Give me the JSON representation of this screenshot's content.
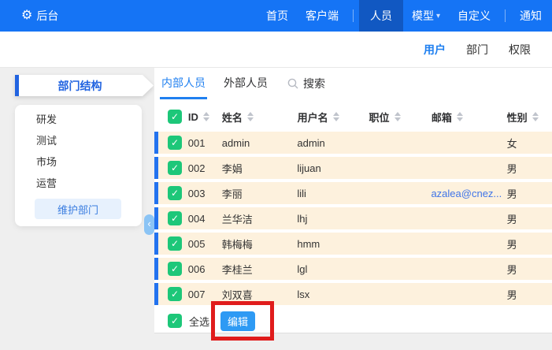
{
  "topbar": {
    "logo": "后台",
    "nav": [
      {
        "label": "首页",
        "active": false
      },
      {
        "label": "客户端",
        "active": false
      },
      {
        "label": "人员",
        "active": true
      },
      {
        "label": "模型",
        "active": false,
        "dropdown": true
      },
      {
        "label": "自定义",
        "active": false
      },
      {
        "label": "通知",
        "active": false
      }
    ]
  },
  "subnav": {
    "tabs": [
      {
        "label": "用户",
        "active": true
      },
      {
        "label": "部门",
        "active": false
      },
      {
        "label": "权限",
        "active": false
      }
    ]
  },
  "sidebar": {
    "title": "部门结构",
    "items": [
      "研发",
      "测试",
      "市场",
      "运营"
    ],
    "maintain_button": "维护部门"
  },
  "content": {
    "tabs": [
      {
        "label": "内部人员",
        "active": true
      },
      {
        "label": "外部人员",
        "active": false
      }
    ],
    "search_label": "搜索",
    "table": {
      "columns": [
        "ID",
        "姓名",
        "用户名",
        "职位",
        "邮箱",
        "性别"
      ],
      "rows": [
        {
          "id": "001",
          "name": "admin",
          "username": "admin",
          "position": "",
          "email": "",
          "gender": "女",
          "checked": true
        },
        {
          "id": "002",
          "name": "李娟",
          "username": "lijuan",
          "position": "",
          "email": "",
          "gender": "男",
          "checked": true
        },
        {
          "id": "003",
          "name": "李丽",
          "username": "lili",
          "position": "",
          "email": "azalea@cnez...",
          "gender": "男",
          "checked": true
        },
        {
          "id": "004",
          "name": "兰华洁",
          "username": "lhj",
          "position": "",
          "email": "",
          "gender": "男",
          "checked": true
        },
        {
          "id": "005",
          "name": "韩梅梅",
          "username": "hmm",
          "position": "",
          "email": "",
          "gender": "男",
          "checked": true
        },
        {
          "id": "006",
          "name": "李桂兰",
          "username": "lgl",
          "position": "",
          "email": "",
          "gender": "男",
          "checked": true
        },
        {
          "id": "007",
          "name": "刘双喜",
          "username": "lsx",
          "position": "",
          "email": "",
          "gender": "男",
          "checked": true
        }
      ],
      "select_all_label": "全选",
      "edit_button_label": "编辑"
    }
  },
  "icons": {
    "gear": "⚙",
    "check": "✓",
    "chevron_left": "‹",
    "caret_down": "▾"
  },
  "colors": {
    "topbar_blue": "#1574f5",
    "topbar_active_blue": "#1158c2",
    "accent_blue": "#2080f0",
    "ribbon_blue": "#2163e0",
    "checkbox_green": "#1dc779",
    "row_background": "#fdf1dd",
    "row_left_bar": "#2272ef",
    "edit_button_blue": "#2e9af4",
    "email_link_blue": "#3f74e8",
    "annotation_red": "#e01c1c",
    "page_background": "#efefef"
  }
}
